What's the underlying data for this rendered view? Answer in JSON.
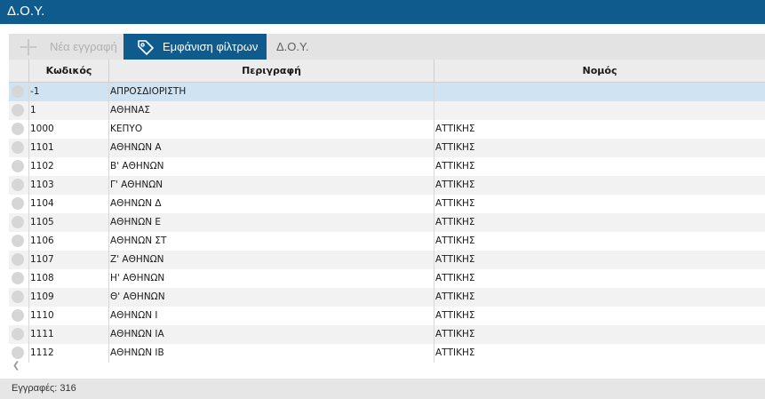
{
  "window": {
    "title": "Δ.Ο.Υ."
  },
  "toolbar": {
    "new_label": "Νέα εγγραφή",
    "filter_label": "Εμφάνιση φίλτρων",
    "entity_label": "Δ.Ο.Υ."
  },
  "grid": {
    "columns": [
      "Κωδικός",
      "Περιγραφή",
      "Νομός"
    ],
    "rows": [
      {
        "code": "-1",
        "description": "ΑΠΡΟΣΔΙΟΡΙΣΤΗ",
        "prefecture": ""
      },
      {
        "code": "1",
        "description": "ΑΘΗΝΑΣ",
        "prefecture": ""
      },
      {
        "code": "1000",
        "description": "ΚΕΠΥΟ",
        "prefecture": "ΑΤΤΙΚΗΣ"
      },
      {
        "code": "1101",
        "description": "ΑΘΗΝΩΝ Α",
        "prefecture": "ΑΤΤΙΚΗΣ"
      },
      {
        "code": "1102",
        "description": "Β' ΑΘΗΝΩΝ",
        "prefecture": "ΑΤΤΙΚΗΣ"
      },
      {
        "code": "1103",
        "description": "Γ' ΑΘΗΝΩΝ",
        "prefecture": "ΑΤΤΙΚΗΣ"
      },
      {
        "code": "1104",
        "description": "ΑΘΗΝΩΝ Δ",
        "prefecture": "ΑΤΤΙΚΗΣ"
      },
      {
        "code": "1105",
        "description": "ΑΘΗΝΩΝ Ε",
        "prefecture": "ΑΤΤΙΚΗΣ"
      },
      {
        "code": "1106",
        "description": "ΑΘΗΝΩΝ ΣΤ",
        "prefecture": "ΑΤΤΙΚΗΣ"
      },
      {
        "code": "1107",
        "description": "Ζ' ΑΘΗΝΩΝ",
        "prefecture": "ΑΤΤΙΚΗΣ"
      },
      {
        "code": "1108",
        "description": "Η' ΑΘΗΝΩΝ",
        "prefecture": "ΑΤΤΙΚΗΣ"
      },
      {
        "code": "1109",
        "description": "Θ' ΑΘΗΝΩΝ",
        "prefecture": "ΑΤΤΙΚΗΣ"
      },
      {
        "code": "1110",
        "description": "ΑΘΗΝΩΝ Ι",
        "prefecture": "ΑΤΤΙΚΗΣ"
      },
      {
        "code": "1111",
        "description": "ΑΘΗΝΩΝ ΙΑ",
        "prefecture": "ΑΤΤΙΚΗΣ"
      },
      {
        "code": "1112",
        "description": "ΑΘΗΝΩΝ ΙΒ",
        "prefecture": "ΑΤΤΙΚΗΣ"
      }
    ],
    "selected_row": 0
  },
  "scrollbar": {
    "left_arrow_icon": "chevron-left-icon"
  },
  "footer": {
    "record_count": "Εγγραφές: 316"
  },
  "colors": {
    "accent": "#0f5b8d",
    "selection": "#cfe3f3"
  }
}
